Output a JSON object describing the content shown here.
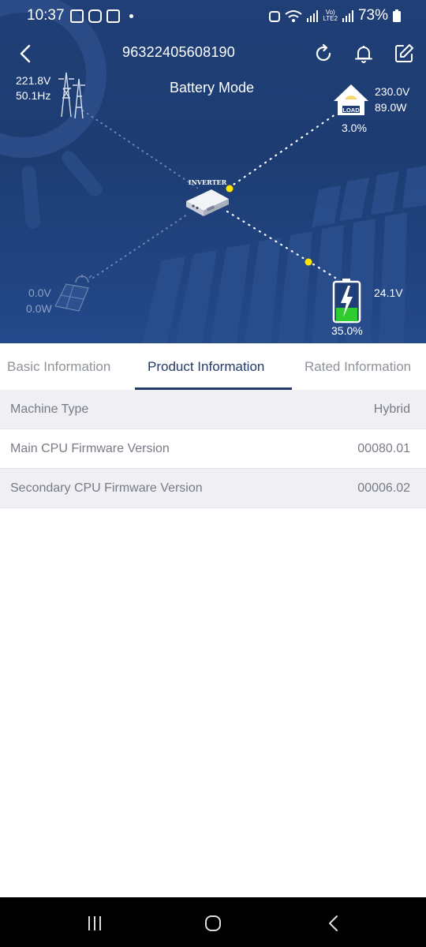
{
  "status_bar": {
    "time": "10:37",
    "battery": "73%",
    "network": "LTE2",
    "volte": "Vo)"
  },
  "header": {
    "device_id": "96322405608190",
    "mode": "Battery Mode",
    "icons": [
      "back-arrow-icon",
      "refresh-icon",
      "bell-icon",
      "edit-icon"
    ]
  },
  "grid": {
    "voltage": "221.8V",
    "frequency": "50.1Hz"
  },
  "load": {
    "voltage": "230.0V",
    "power": "89.0W",
    "percent": "3.0%",
    "badge": "LOAD"
  },
  "solar": {
    "voltage": "0.0V",
    "power": "0.0W"
  },
  "battery": {
    "voltage": "24.1V",
    "percent": "35.0%",
    "charge_level": 0.35
  },
  "inverter": {
    "label": "INVERTER"
  },
  "tabs": [
    {
      "label": "Basic Information",
      "active": false
    },
    {
      "label": "Product Information",
      "active": true
    },
    {
      "label": "Rated Information",
      "active": false
    }
  ],
  "product_info": [
    {
      "key": "Machine Type",
      "value": "Hybrid"
    },
    {
      "key": "Main CPU Firmware Version",
      "value": "00080.01"
    },
    {
      "key": "Secondary CPU Firmware Version",
      "value": "00006.02"
    }
  ],
  "colors": {
    "header_bg": "#1f3f76",
    "tab_active": "#233a67",
    "flow_dot": "#ffe600",
    "battery_fill": "#2ecc2e"
  }
}
